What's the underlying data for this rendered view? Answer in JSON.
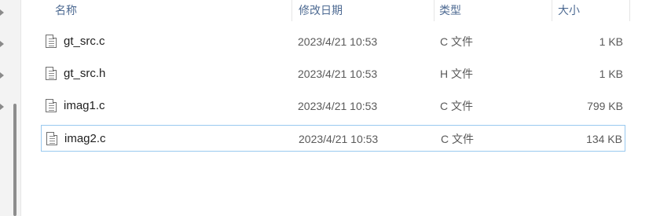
{
  "columns": {
    "name": "名称",
    "modified": "修改日期",
    "type": "类型",
    "size": "大小"
  },
  "files": [
    {
      "name": "gt_src.c",
      "modified": "2023/4/21 10:53",
      "type": "C 文件",
      "size": "1 KB",
      "icon": "file-icon"
    },
    {
      "name": "gt_src.h",
      "modified": "2023/4/21 10:53",
      "type": "H 文件",
      "size": "1 KB",
      "icon": "file-icon"
    },
    {
      "name": "imag1.c",
      "modified": "2023/4/21 10:53",
      "type": "C 文件",
      "size": "799 KB",
      "icon": "file-icon"
    },
    {
      "name": "imag2.c",
      "modified": "2023/4/21 10:53",
      "type": "C 文件",
      "size": "134 KB",
      "icon": "file-icon",
      "selected": true
    }
  ],
  "colors": {
    "header_text": "#4d6a92",
    "selection_border": "#99c9ef"
  }
}
